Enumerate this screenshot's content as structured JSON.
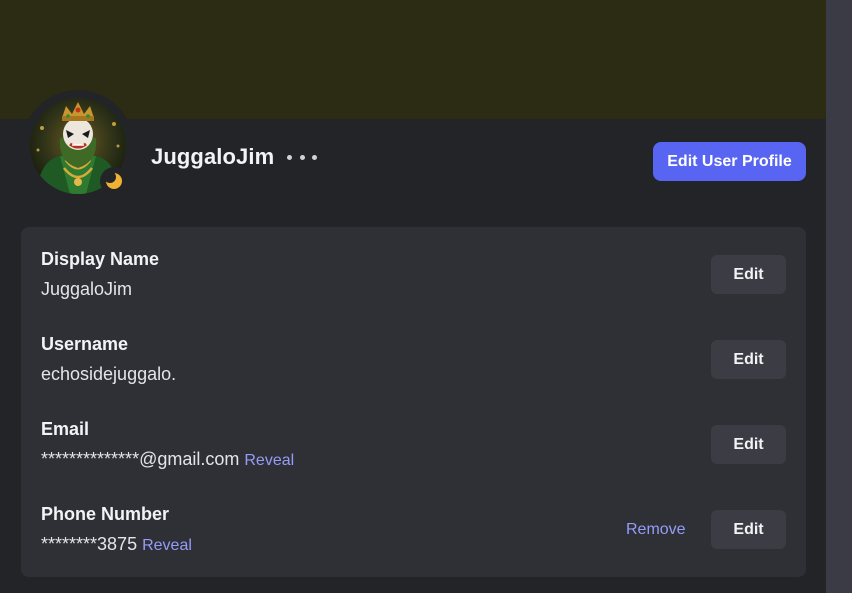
{
  "profile": {
    "username": "JuggaloJim",
    "more_icon": "ellipsis-icon",
    "status": "idle",
    "status_icon": "moon-icon",
    "edit_profile_label": "Edit User Profile"
  },
  "colors": {
    "accent": "#5865f2",
    "link": "#949cf7",
    "banner": "#2c2b13",
    "idle_status": "#f0b232"
  },
  "fields": [
    {
      "label": "Display Name",
      "value": "JuggaloJim",
      "reveal": "",
      "remove": "",
      "edit": "Edit"
    },
    {
      "label": "Username",
      "value": "echosidejuggalo.",
      "reveal": "",
      "remove": "",
      "edit": "Edit"
    },
    {
      "label": "Email",
      "value": "**************@gmail.com",
      "reveal": "Reveal",
      "remove": "",
      "edit": "Edit"
    },
    {
      "label": "Phone Number",
      "value": "********3875",
      "reveal": "Reveal",
      "remove": "Remove",
      "edit": "Edit"
    }
  ]
}
